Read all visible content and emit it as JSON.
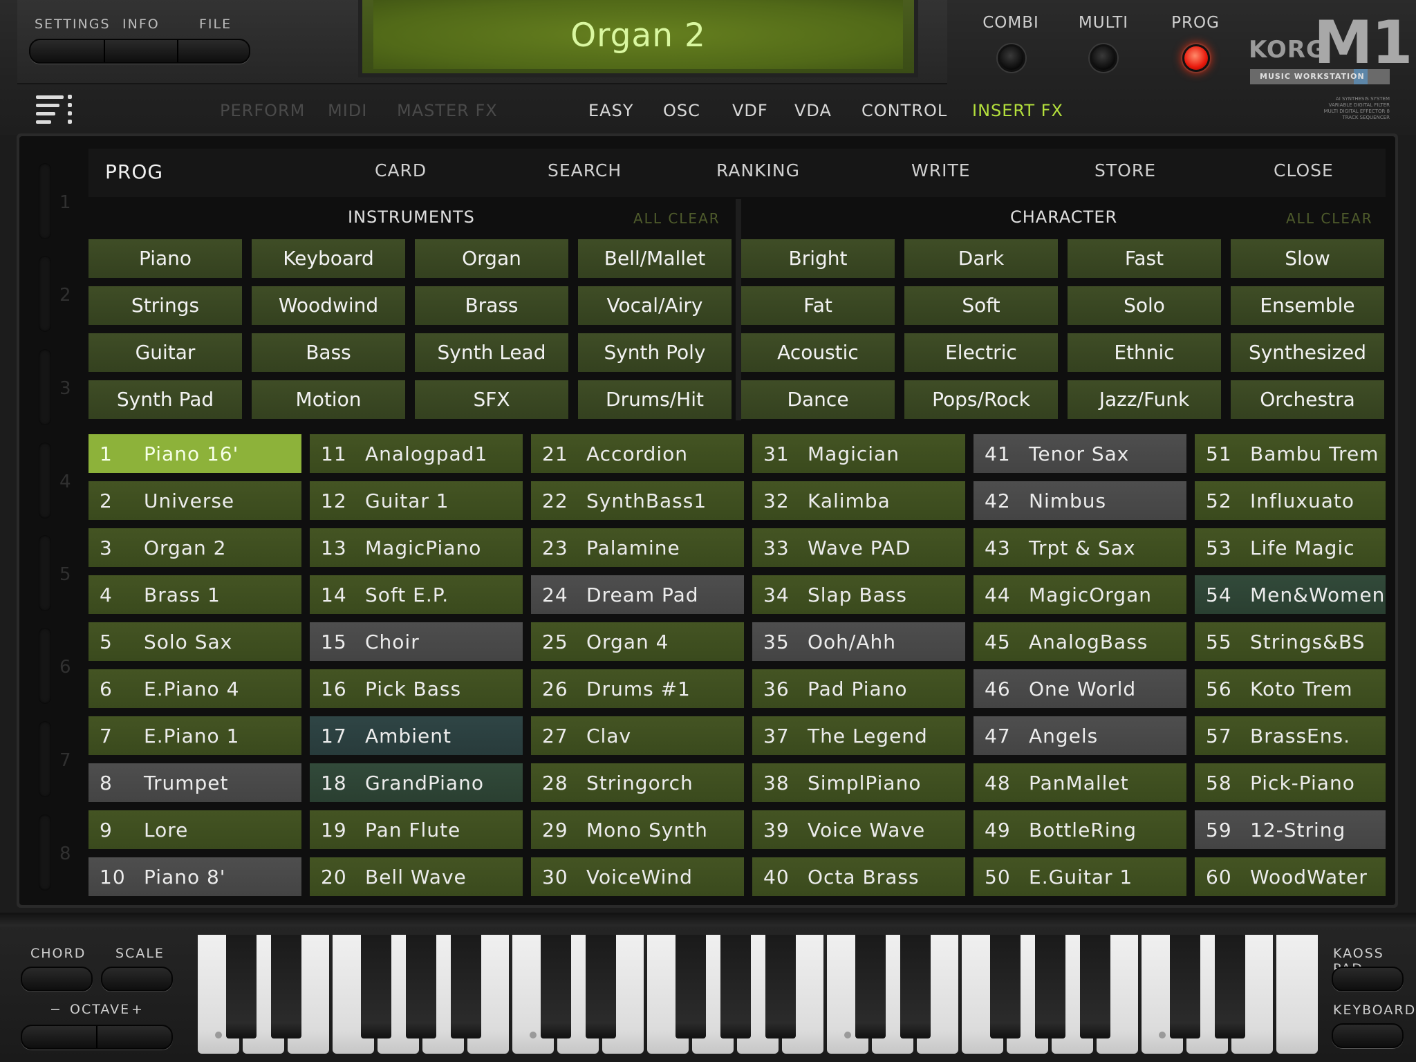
{
  "header": {
    "left_menu": [
      "SETTINGS",
      "INFO",
      "FILE"
    ],
    "lcd_display": "Organ 2",
    "modes": [
      {
        "label": "COMBI",
        "active": false
      },
      {
        "label": "MULTI",
        "active": false
      },
      {
        "label": "PROG",
        "active": true
      }
    ],
    "logo": {
      "brand": "KORG",
      "model": "M1",
      "strip": "MUSIC WORKSTATION",
      "small_text": "AI SYNTHESIS SYSTEM VARIABLE DIGITAL FILTER MULTI DIGITAL EFFECTOR 8 TRACK SEQUENCER"
    },
    "indicator_color": "#e8190c"
  },
  "nav": {
    "dim_tabs": [
      "PERFORM",
      "MIDI",
      "MASTER FX"
    ],
    "tabs": [
      "EASY",
      "OSC",
      "VDF",
      "VDA",
      "CONTROL",
      "INSERT FX"
    ],
    "active_tab": "INSERT FX",
    "accent": "#b4e03c"
  },
  "browser": {
    "title": "PROG",
    "tabs": [
      "CARD",
      "SEARCH",
      "RANKING",
      "WRITE",
      "STORE",
      "CLOSE"
    ],
    "active_tab": "RANKING",
    "instruments_header": "INSTRUMENTS",
    "character_header": "CHARACTER",
    "all_clear": "ALL CLEAR",
    "instruments": [
      [
        "Piano",
        "Keyboard",
        "Organ",
        "Bell/Mallet"
      ],
      [
        "Strings",
        "Woodwind",
        "Brass",
        "Vocal/Airy"
      ],
      [
        "Guitar",
        "Bass",
        "Synth Lead",
        "Synth Poly"
      ],
      [
        "Synth Pad",
        "Motion",
        "SFX",
        "Drums/Hit"
      ]
    ],
    "character": [
      [
        "Bright",
        "Dark",
        "Fast",
        "Slow"
      ],
      [
        "Fat",
        "Soft",
        "Solo",
        "Ensemble"
      ],
      [
        "Acoustic",
        "Electric",
        "Ethnic",
        "Synthesized"
      ],
      [
        "Dance",
        "Pops/Rock",
        "Jazz/Funk",
        "Orchestra"
      ]
    ],
    "side_numbers": [
      "1",
      "2",
      "3",
      "4",
      "5",
      "6",
      "7",
      "8"
    ],
    "selected_program": 1,
    "programs": [
      {
        "n": "1",
        "name": "Piano 16'",
        "style": "sel"
      },
      {
        "n": "2",
        "name": "Universe",
        "style": ""
      },
      {
        "n": "3",
        "name": "Organ 2",
        "style": ""
      },
      {
        "n": "4",
        "name": "Brass 1",
        "style": ""
      },
      {
        "n": "5",
        "name": "Solo Sax",
        "style": ""
      },
      {
        "n": "6",
        "name": "E.Piano 4",
        "style": ""
      },
      {
        "n": "7",
        "name": "E.Piano 1",
        "style": ""
      },
      {
        "n": "8",
        "name": "Trumpet",
        "style": "grey"
      },
      {
        "n": "9",
        "name": "Lore",
        "style": ""
      },
      {
        "n": "10",
        "name": "Piano 8'",
        "style": "grey"
      },
      {
        "n": "11",
        "name": "Analogpad1",
        "style": ""
      },
      {
        "n": "12",
        "name": "Guitar 1",
        "style": ""
      },
      {
        "n": "13",
        "name": "MagicPiano",
        "style": ""
      },
      {
        "n": "14",
        "name": "Soft E.P.",
        "style": ""
      },
      {
        "n": "15",
        "name": "Choir",
        "style": "grey"
      },
      {
        "n": "16",
        "name": "Pick Bass",
        "style": ""
      },
      {
        "n": "17",
        "name": "Ambient",
        "style": "teal"
      },
      {
        "n": "18",
        "name": "GrandPiano",
        "style": "teal2"
      },
      {
        "n": "19",
        "name": "Pan Flute",
        "style": ""
      },
      {
        "n": "20",
        "name": "Bell Wave",
        "style": ""
      },
      {
        "n": "21",
        "name": "Accordion",
        "style": ""
      },
      {
        "n": "22",
        "name": "SynthBass1",
        "style": ""
      },
      {
        "n": "23",
        "name": "Palamine",
        "style": ""
      },
      {
        "n": "24",
        "name": "Dream Pad",
        "style": "grey"
      },
      {
        "n": "25",
        "name": "Organ 4",
        "style": ""
      },
      {
        "n": "26",
        "name": "Drums #1",
        "style": ""
      },
      {
        "n": "27",
        "name": "Clav",
        "style": ""
      },
      {
        "n": "28",
        "name": "Stringorch",
        "style": ""
      },
      {
        "n": "29",
        "name": "Mono Synth",
        "style": ""
      },
      {
        "n": "30",
        "name": "VoiceWind",
        "style": ""
      },
      {
        "n": "31",
        "name": "Magician",
        "style": ""
      },
      {
        "n": "32",
        "name": "Kalimba",
        "style": ""
      },
      {
        "n": "33",
        "name": "Wave PAD",
        "style": ""
      },
      {
        "n": "34",
        "name": "Slap Bass",
        "style": ""
      },
      {
        "n": "35",
        "name": "Ooh/Ahh",
        "style": "grey"
      },
      {
        "n": "36",
        "name": "Pad Piano",
        "style": ""
      },
      {
        "n": "37",
        "name": "The Legend",
        "style": ""
      },
      {
        "n": "38",
        "name": "SimplPiano",
        "style": ""
      },
      {
        "n": "39",
        "name": "Voice Wave",
        "style": ""
      },
      {
        "n": "40",
        "name": "Octa Brass",
        "style": ""
      },
      {
        "n": "41",
        "name": "Tenor Sax",
        "style": "grey"
      },
      {
        "n": "42",
        "name": "Nimbus",
        "style": "grey"
      },
      {
        "n": "43",
        "name": "Trpt & Sax",
        "style": ""
      },
      {
        "n": "44",
        "name": "MagicOrgan",
        "style": ""
      },
      {
        "n": "45",
        "name": "AnalogBass",
        "style": ""
      },
      {
        "n": "46",
        "name": "One World",
        "style": "grey"
      },
      {
        "n": "47",
        "name": "Angels",
        "style": "grey"
      },
      {
        "n": "48",
        "name": "PanMallet",
        "style": ""
      },
      {
        "n": "49",
        "name": "BottleRing",
        "style": ""
      },
      {
        "n": "50",
        "name": "E.Guitar 1",
        "style": ""
      },
      {
        "n": "51",
        "name": "Bambu Trem",
        "style": ""
      },
      {
        "n": "52",
        "name": "Influxuato",
        "style": ""
      },
      {
        "n": "53",
        "name": "Life Magic",
        "style": ""
      },
      {
        "n": "54",
        "name": "Men&Women",
        "style": "teal2"
      },
      {
        "n": "55",
        "name": "Strings&BS",
        "style": ""
      },
      {
        "n": "56",
        "name": "Koto Trem",
        "style": ""
      },
      {
        "n": "57",
        "name": "BrassEns.",
        "style": ""
      },
      {
        "n": "58",
        "name": "Pick-Piano",
        "style": ""
      },
      {
        "n": "59",
        "name": "12-String",
        "style": "grey"
      },
      {
        "n": "60",
        "name": "WoodWater",
        "style": ""
      }
    ]
  },
  "bottom": {
    "chord": "CHORD",
    "scale": "SCALE",
    "octave": "OCTAVE",
    "octave_minus": "−",
    "octave_plus": "+",
    "kaoss_pad": "KAOSS PAD",
    "keyboard": "KEYBOARD"
  }
}
